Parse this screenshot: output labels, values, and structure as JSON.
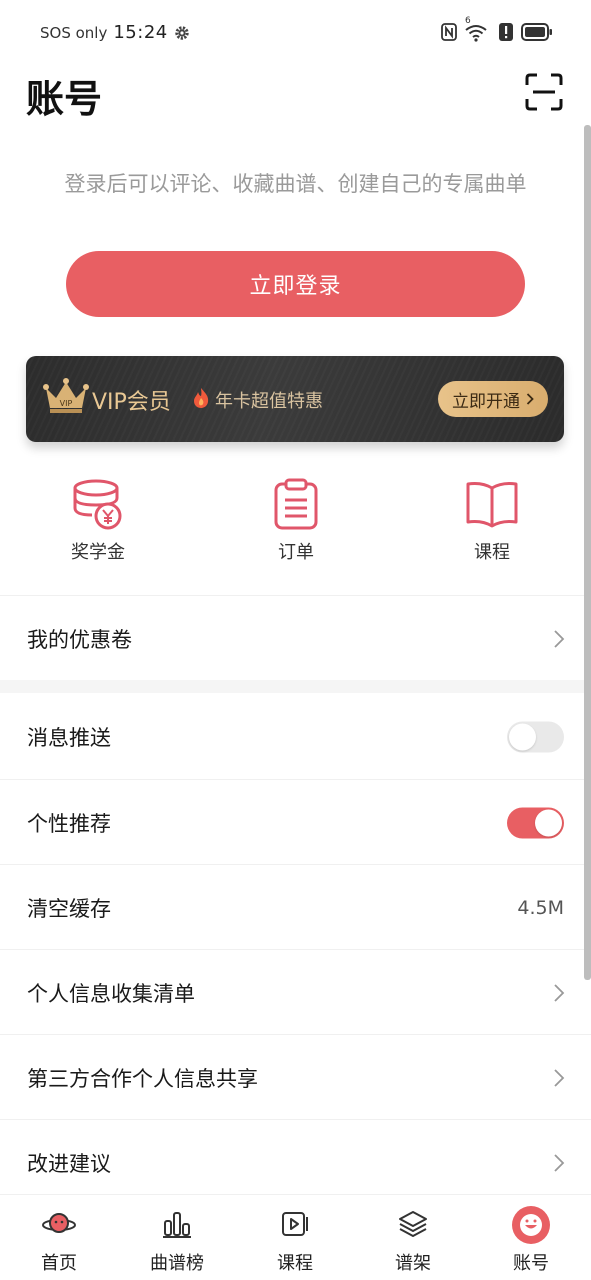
{
  "status_bar": {
    "carrier": "SOS only",
    "time": "15:24",
    "network_badge": "6",
    "icons": [
      "gear-icon",
      "nfc-icon",
      "wifi-icon",
      "alert-icon",
      "battery-icon"
    ]
  },
  "header": {
    "title": "账号",
    "scan_icon": "scan-icon"
  },
  "login": {
    "hint": "登录后可以评论、收藏曲谱、创建自己的专属曲单",
    "button_label": "立即登录"
  },
  "vip_banner": {
    "crown_text": "VIP",
    "title": "VIP会员",
    "offer": "年卡超值特惠",
    "cta": "立即开通"
  },
  "quick_entries": [
    {
      "label": "奖学金",
      "icon": "coins-icon"
    },
    {
      "label": "订单",
      "icon": "clipboard-icon"
    },
    {
      "label": "课程",
      "icon": "book-icon"
    }
  ],
  "menu": {
    "coupons": "我的优惠卷",
    "push": {
      "label": "消息推送",
      "enabled": false
    },
    "recommend": {
      "label": "个性推荐",
      "enabled": true
    },
    "cache": {
      "label": "清空缓存",
      "value": "4.5M"
    },
    "personal_info": "个人信息收集清单",
    "third_party": "第三方合作个人信息共享",
    "feedback": "改进建议"
  },
  "bottom_nav": [
    {
      "label": "首页",
      "icon": "home-planet-icon"
    },
    {
      "label": "曲谱榜",
      "icon": "chart-icon"
    },
    {
      "label": "课程",
      "icon": "video-icon"
    },
    {
      "label": "谱架",
      "icon": "layers-icon"
    },
    {
      "label": "账号",
      "icon": "account-icon",
      "active": true
    }
  ],
  "colors": {
    "accent": "#e85f63",
    "vip_gold": "#e9c894",
    "hint_gray": "#9a9a9a"
  }
}
